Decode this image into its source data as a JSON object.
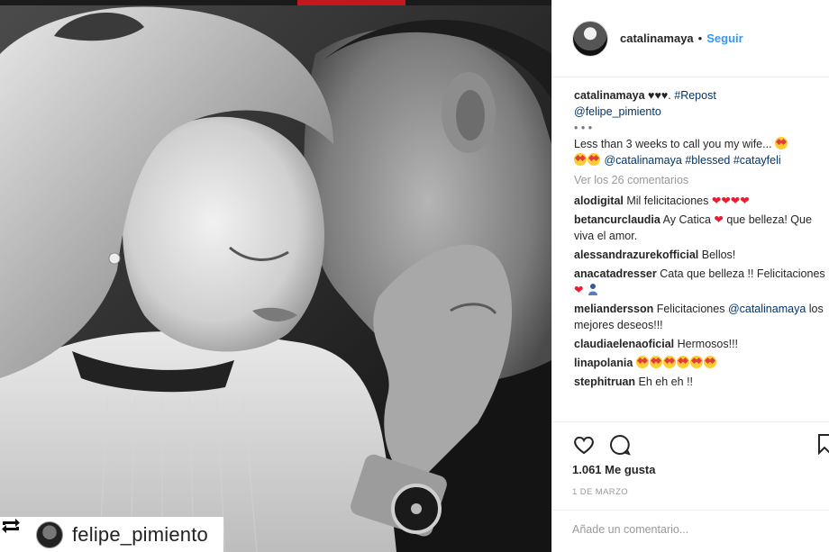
{
  "photo": {
    "alt": "",
    "repost_tag": {
      "username": "felipe_pimiento",
      "icon": "repost-icon"
    }
  },
  "post": {
    "username": "catalinamaya",
    "follow_label": "Seguir",
    "caption": {
      "username": "catalinamaya",
      "hearts": "♥︎♥︎♥︎.",
      "tag": "#Repost",
      "mention": "@felipe_pimiento",
      "dots": "• • •",
      "text": "Less than 3 weeks to call you my wife...",
      "mention2": "@catalinamaya",
      "tags": "#blessed #catayfeli"
    },
    "view_all": "Ver los 26 comentarios",
    "comments": [
      {
        "user": "alodigital",
        "text": "Mil felicitaciones",
        "suffix": "❤❤❤❤"
      },
      {
        "user": "betancurclaudia",
        "text": "Ay Catica",
        "text2": "que belleza! Que viva el amor.",
        "suffix": "❤"
      },
      {
        "user": "alessandrazurekofficial",
        "text": "Bellos!"
      },
      {
        "user": "anacatadresser",
        "text": "Cata que belleza !! Felicitaciones",
        "suffix": "❤"
      },
      {
        "user": "meliandersson",
        "text": "Felicitaciones",
        "mention": "@catalinamaya",
        "text2": "los mejores deseos!!!"
      },
      {
        "user": "claudiaelenaoficial",
        "text": "Hermosos!!!"
      },
      {
        "user": "linapolania",
        "text": ""
      },
      {
        "user": "stephitruan",
        "text": "Eh eh eh !!"
      }
    ],
    "likes": "1.061 Me gusta",
    "date": "1 DE MARZO",
    "add_comment_placeholder": "Añade un comentario..."
  },
  "colors": {
    "link": "#003569",
    "follow": "#3897f0",
    "muted": "#999999",
    "heart": "#ed1b2e"
  },
  "icons": [
    "repost-icon",
    "heart-icon",
    "comment-icon",
    "bookmark-icon",
    "heart-eyes-emoji",
    "pray-emoji"
  ]
}
